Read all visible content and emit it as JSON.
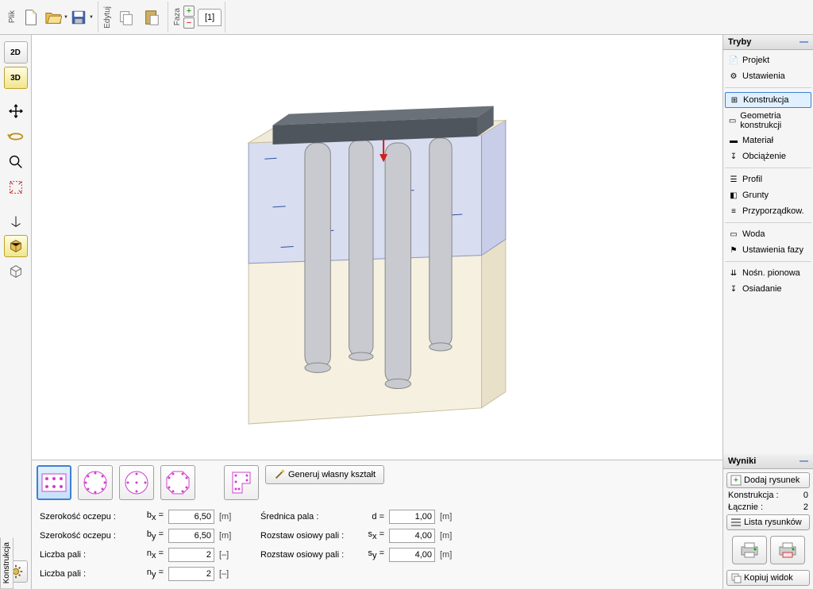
{
  "toolbar": {
    "groups": {
      "file": "Plik",
      "edit": "Edytuj",
      "phase": "Faza"
    },
    "phase_tab": "[1]"
  },
  "left_tools": {
    "b2d": "2D",
    "b3d": "3D"
  },
  "modes_panel": {
    "title": "Tryby",
    "items": [
      "Projekt",
      "Ustawienia",
      "Konstrukcja",
      "Geometria konstrukcji",
      "Materiał",
      "Obciążenie",
      "Profil",
      "Grunty",
      "Przyporządkow.",
      "Woda",
      "Ustawienia fazy",
      "Nośn. pionowa",
      "Osiadanie"
    ],
    "selected_index": 2
  },
  "results_panel": {
    "title": "Wyniki",
    "add_drawing": "Dodaj rysunek",
    "construction_label": "Konstrukcja :",
    "construction_val": "0",
    "total_label": "Łącznie :",
    "total_val": "2",
    "list_drawings": "Lista rysunków",
    "copy_view": "Kopiuj widok"
  },
  "bottom": {
    "generate": "Generuj własny kształt",
    "vertical_tab": "Konstrukcja",
    "params": {
      "col1": [
        {
          "label": "Szerokość oczepu :",
          "sym": "b<sub>x</sub> =",
          "val": "6,50",
          "unit": "[m]"
        },
        {
          "label": "Szerokość oczepu :",
          "sym": "b<sub>y</sub> =",
          "val": "6,50",
          "unit": "[m]"
        },
        {
          "label": "Liczba pali :",
          "sym": "n<sub>x</sub> =",
          "val": "2",
          "unit": "[–]"
        },
        {
          "label": "Liczba pali :",
          "sym": "n<sub>y</sub> =",
          "val": "2",
          "unit": "[–]"
        }
      ],
      "col2": [
        {
          "label": "Średnica pala :",
          "sym": "d =",
          "val": "1,00",
          "unit": "[m]"
        },
        {
          "label": "Rozstaw osiowy pali :",
          "sym": "s<sub>x</sub> =",
          "val": "4,00",
          "unit": "[m]"
        },
        {
          "label": "Rozstaw osiowy pali :",
          "sym": "s<sub>y</sub> =",
          "val": "4,00",
          "unit": "[m]"
        }
      ]
    }
  }
}
